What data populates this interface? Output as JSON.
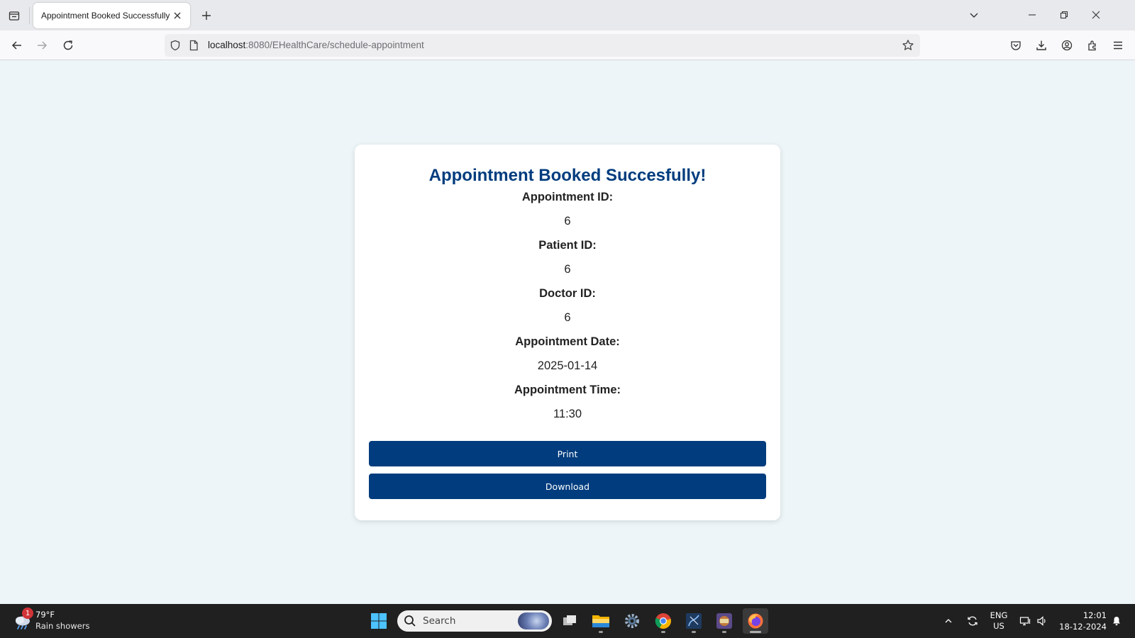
{
  "browser": {
    "tab_title": "Appointment Booked Successfully",
    "url_host": "localhost",
    "url_rest": ":8080/EHealthCare/schedule-appointment"
  },
  "card": {
    "title": "Appointment Booked Succesfully!",
    "fields": [
      {
        "label": "Appointment ID:",
        "value": "6"
      },
      {
        "label": "Patient ID:",
        "value": "6"
      },
      {
        "label": "Doctor ID:",
        "value": "6"
      },
      {
        "label": "Appointment Date:",
        "value": "2025-01-14"
      },
      {
        "label": "Appointment Time:",
        "value": "11:30"
      }
    ],
    "print_label": "Print",
    "download_label": "Download",
    "accent_color": "#003c7e"
  },
  "taskbar": {
    "weather_badge": "1",
    "weather_temp": "79°F",
    "weather_desc": "Rain showers",
    "search_placeholder": "Search",
    "lang_primary": "ENG",
    "lang_secondary": "US",
    "time": "12:01",
    "date": "18-12-2024"
  }
}
